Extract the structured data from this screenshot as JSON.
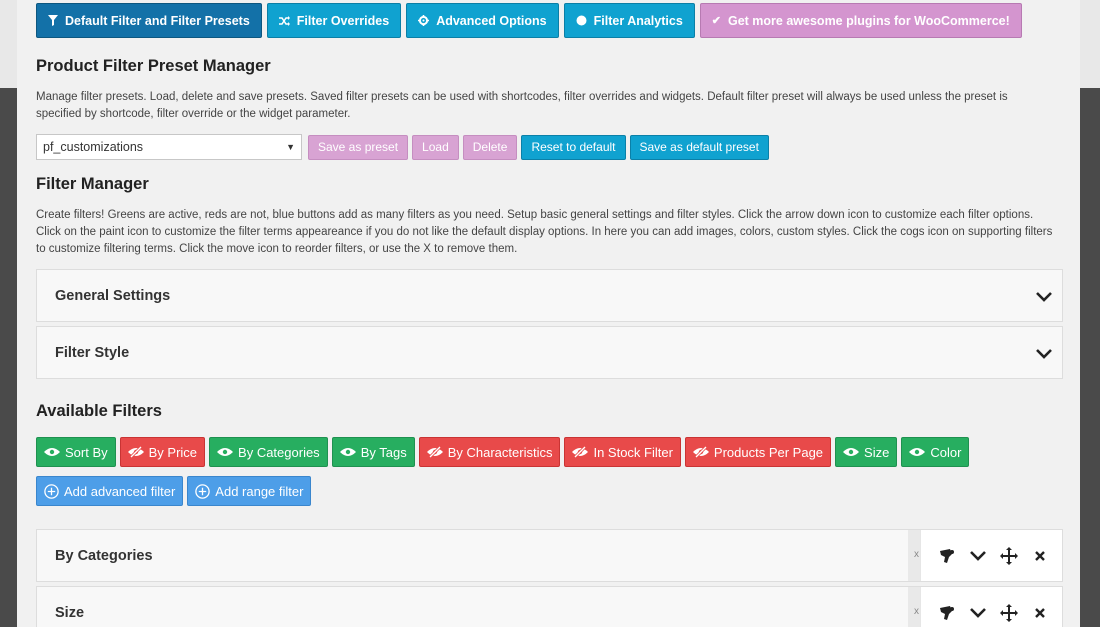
{
  "tabs": [
    {
      "label": "Default Filter and Filter Presets",
      "icon": "filter-icon"
    },
    {
      "label": "Filter Overrides",
      "icon": "shuffle-icon"
    },
    {
      "label": "Advanced Options",
      "icon": "gear-icon"
    },
    {
      "label": "Filter Analytics",
      "icon": "pie-chart-icon"
    },
    {
      "label": "Get more awesome plugins for WooCommerce!",
      "icon": "check-icon"
    }
  ],
  "preset_manager": {
    "title": "Product Filter Preset Manager",
    "description": "Manage filter presets. Load, delete and save presets. Saved filter presets can be used with shortcodes, filter overrides and widgets. Default filter preset will always be used unless the preset is specified by shortcode, filter override or the widget parameter.",
    "selected_preset": "pf_customizations",
    "buttons": {
      "save_as_preset": "Save as preset",
      "load": "Load",
      "delete": "Delete",
      "reset_to_default": "Reset to default",
      "save_as_default": "Save as default preset"
    }
  },
  "filter_manager": {
    "title": "Filter Manager",
    "description": "Create filters! Greens are active, reds are not, blue buttons add as many filters as you need. Setup basic general settings and filter styles. Click the arrow down icon to customize each filter options. Click on the paint icon to customize the filter terms appeareance if you do not like the default display options. In here you can add images, colors, custom styles. Click the cogs icon on supporting filters to customize filtering terms. Click the move icon to reorder filters, or use the X to remove them.",
    "sections": [
      "General Settings",
      "Filter Style"
    ]
  },
  "available_filters": {
    "title": "Available Filters",
    "items": [
      {
        "label": "Sort By",
        "state": "active"
      },
      {
        "label": "By Price",
        "state": "inactive"
      },
      {
        "label": "By Categories",
        "state": "active"
      },
      {
        "label": "By Tags",
        "state": "active"
      },
      {
        "label": "By Characteristics",
        "state": "inactive"
      },
      {
        "label": "In Stock Filter",
        "state": "inactive"
      },
      {
        "label": "Products Per Page",
        "state": "inactive"
      },
      {
        "label": "Size",
        "state": "active"
      },
      {
        "label": "Color",
        "state": "active"
      },
      {
        "label": "Add advanced filter",
        "state": "add"
      },
      {
        "label": "Add range filter",
        "state": "add"
      }
    ]
  },
  "filter_rows": [
    {
      "label": "By Categories",
      "small_x": "x"
    },
    {
      "label": "Size",
      "small_x": "x"
    }
  ],
  "colors": {
    "active_green": "#27ae60",
    "inactive_red": "#e84a4a",
    "add_blue": "#4d9ee8",
    "tab_blue": "#10a2d0",
    "tab_active": "#1371a8",
    "promo_pink": "#d495cf"
  }
}
